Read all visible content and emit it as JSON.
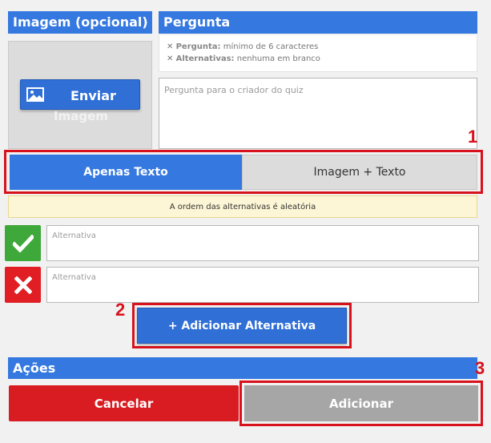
{
  "image_section": {
    "header": "Imagem (opcional)",
    "upload_label_1": "Enviar",
    "upload_label_2": "Imagem"
  },
  "question_section": {
    "header": "Pergunta",
    "rules": [
      {
        "label": "Pergunta:",
        "text": "mínimo de 6 caracteres"
      },
      {
        "label": "Alternativas:",
        "text": "nenhuma em branco"
      }
    ],
    "placeholder": "Pergunta para o criador do quiz"
  },
  "toggle": {
    "text_only": "Apenas Texto",
    "image_text": "Imagem + Texto"
  },
  "notice": "A ordem das alternativas é aleatória",
  "alternatives": [
    {
      "status": "correct",
      "placeholder": "Alternativa"
    },
    {
      "status": "wrong",
      "placeholder": "Alternativa"
    }
  ],
  "add_alternative": {
    "icon": "plus-icon",
    "label": "+ Adicionar Alternativa"
  },
  "markers": [
    "1",
    "2",
    "3"
  ],
  "actions": {
    "header": "Ações",
    "cancel": "Cancelar",
    "submit": "Adicionar"
  },
  "colors": {
    "primary": "#3478e0",
    "danger": "#d81c21",
    "success": "#3fa83a",
    "disabled": "#a6a6a6",
    "highlight": "#d8121c"
  }
}
